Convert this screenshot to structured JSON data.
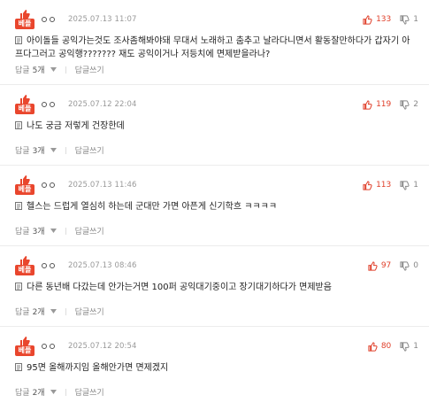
{
  "colors": {
    "accent": "#e9462d",
    "upvote": "#e0402b",
    "muted": "#999999"
  },
  "badge_label": "베플",
  "reply_label_prefix": "답글",
  "write_reply_label": "답글쓰기",
  "comments": [
    {
      "date": "2025.07.13 11:07",
      "text": "아이돌들 공익가는것도 조사좀해봐야돼 무대서 노래하고 춤추고 날라다니면서 활동잘만하다가 갑자기 아프다그러고 공익행??????? 재도 공익이거나 저등치에 면제받을라나?",
      "up": "133",
      "down": "1",
      "replies": "5개"
    },
    {
      "date": "2025.07.12 22:04",
      "text": "나도 궁금 저렇게 건장한데",
      "up": "119",
      "down": "2",
      "replies": "3개"
    },
    {
      "date": "2025.07.13 11:46",
      "text": "헬스는 드럽게 열심히 하는데 군대만 가면 아픈게 신기학흐 ㅋㅋㅋㅋ",
      "up": "113",
      "down": "1",
      "replies": "3개"
    },
    {
      "date": "2025.07.13 08:46",
      "text": "다른 동년배 다갔는데 안가는거면 100퍼 공익대기중이고 장기대기하다가 면제받음",
      "up": "97",
      "down": "0",
      "replies": "2개"
    },
    {
      "date": "2025.07.12 20:54",
      "text": "95면 올해까지임 올해안가면 면제겠지",
      "up": "80",
      "down": "1",
      "replies": "2개"
    }
  ]
}
